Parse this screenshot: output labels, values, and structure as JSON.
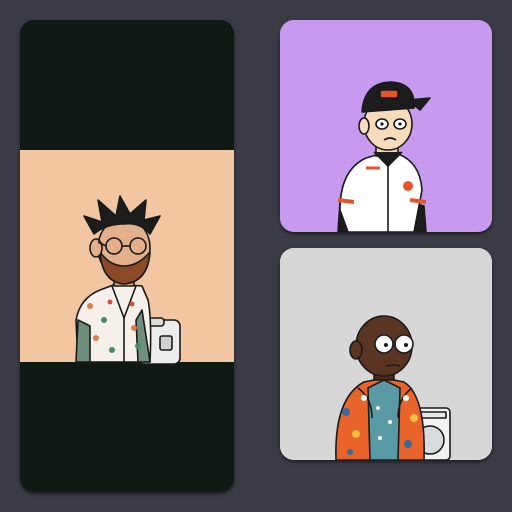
{
  "gallery": {
    "cards": [
      {
        "id": "left",
        "subject": "bearded-man-with-glasses",
        "background_color": "#101a15",
        "art_background_color": "#f1c6a0",
        "shirt_color": "#f5f1ea",
        "accent_color": "#e07a4a"
      },
      {
        "id": "top-right",
        "subject": "baseball-player",
        "background_color": "#c79af0",
        "shirt_color": "#ffffff",
        "accent_color": "#e8542a"
      },
      {
        "id": "bottom-right",
        "subject": "bald-man-with-glasses",
        "background_color": "#d7d7d7",
        "jacket_color": "#e8642a",
        "shirt_color": "#5a9aa5",
        "skin_color": "#5a3524"
      }
    ]
  },
  "colors": {
    "page_background": "#3b3b45",
    "outline": "#1a1a1a"
  }
}
